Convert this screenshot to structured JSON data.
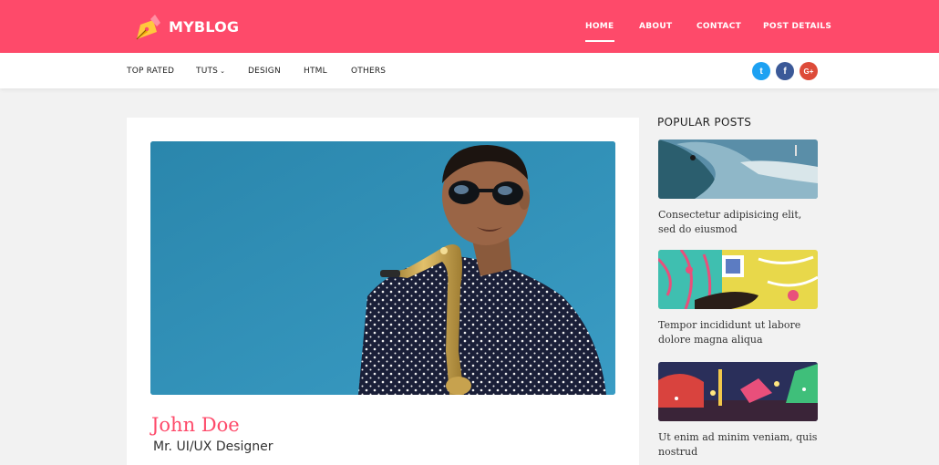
{
  "brand": {
    "name": "MYBLOG"
  },
  "nav": {
    "home": "HOME",
    "about": "ABOUT",
    "contact": "CONTACT",
    "post_details": "POST DETAILS"
  },
  "subnav": {
    "top_rated": "TOP RATED",
    "tuts": "TUTS",
    "design": "DESIGN",
    "html": "HTML",
    "others": "OTHERS"
  },
  "social": {
    "twitter": "t",
    "facebook": "f",
    "google_plus": "G+"
  },
  "author": {
    "name": "John Doe",
    "role": "Mr. UI/UX Designer"
  },
  "sidebar": {
    "title": "POPULAR POSTS",
    "posts": [
      {
        "title": "Consectetur adipisicing elit, sed do eiusmod"
      },
      {
        "title": "Tempor incididunt ut labore dolore magna aliqua"
      },
      {
        "title": "Ut enim ad minim veniam, quis nostrud"
      }
    ]
  },
  "colors": {
    "brand": "#fe4a6a",
    "twitter": "#1da1f2",
    "facebook": "#3b5998",
    "google_plus": "#dd4b39"
  }
}
